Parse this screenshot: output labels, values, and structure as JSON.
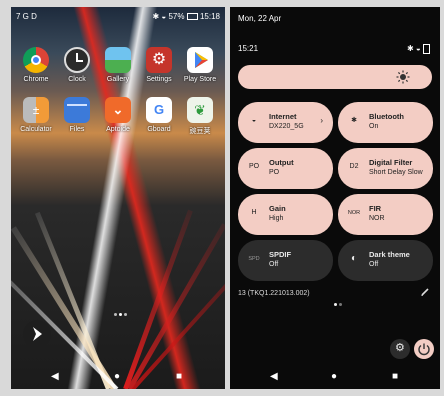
{
  "left": {
    "status": {
      "left": "7 G D",
      "battery": "57%",
      "time": "15:18"
    },
    "apps": [
      {
        "label": "Chrome"
      },
      {
        "label": "Clock"
      },
      {
        "label": "Gallery"
      },
      {
        "label": "Settings"
      },
      {
        "label": "Play Store"
      },
      {
        "label": "Calculator"
      },
      {
        "label": "Files"
      },
      {
        "label": "Aptoide"
      },
      {
        "label": "Gboard"
      },
      {
        "label": "豌豆荚"
      }
    ],
    "nav": {
      "back": "◀",
      "home": "●",
      "recents": "■"
    }
  },
  "right": {
    "date": "Mon, 22 Apr",
    "time": "15:21",
    "tiles": [
      {
        "title": "Internet",
        "subtitle": "DX220_5G",
        "icon": "W",
        "chevron": "›"
      },
      {
        "title": "Bluetooth",
        "subtitle": "On",
        "icon": "✱"
      },
      {
        "title": "Output",
        "subtitle": "PO",
        "icon": "PO"
      },
      {
        "title": "Digital Filter",
        "subtitle": "Short Delay Slow",
        "icon": "D2"
      },
      {
        "title": "Gain",
        "subtitle": "High",
        "icon": "H"
      },
      {
        "title": "FIR",
        "subtitle": "NOR",
        "icon": "NOR"
      },
      {
        "title": "SPDIF",
        "subtitle": "Off",
        "icon": "SPD"
      },
      {
        "title": "Dark theme",
        "subtitle": "Off",
        "icon": "◐"
      }
    ],
    "build": "13 (TKQ1.221013.002)",
    "nav": {
      "back": "◀",
      "home": "●",
      "recents": "■"
    }
  }
}
